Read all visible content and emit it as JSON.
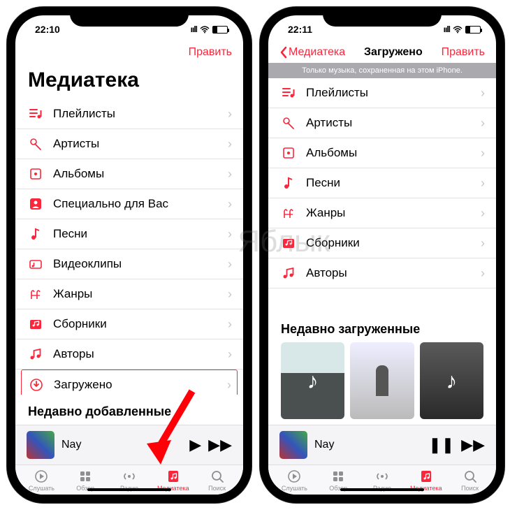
{
  "watermark": "Яблык",
  "phone1": {
    "status_time": "22:10",
    "edit_label": "Править",
    "title": "Медиатека",
    "rows": [
      {
        "icon": "playlist",
        "label": "Плейлисты"
      },
      {
        "icon": "mic",
        "label": "Артисты"
      },
      {
        "icon": "album",
        "label": "Альбомы"
      },
      {
        "icon": "foryou",
        "label": "Специально для Вас"
      },
      {
        "icon": "note",
        "label": "Песни"
      },
      {
        "icon": "video",
        "label": "Видеоклипы"
      },
      {
        "icon": "genre",
        "label": "Жанры"
      },
      {
        "icon": "compilation",
        "label": "Сборники"
      },
      {
        "icon": "composer",
        "label": "Авторы"
      },
      {
        "icon": "download",
        "label": "Загружено",
        "highlight": true
      }
    ],
    "recent_header": "Недавно добавленные",
    "now_playing": "Nay",
    "tabs": [
      {
        "label": "Слушать"
      },
      {
        "label": "Обзор"
      },
      {
        "label": "Радио"
      },
      {
        "label": "Медиатека",
        "active": true
      },
      {
        "label": "Поиск"
      }
    ]
  },
  "phone2": {
    "status_time": "22:11",
    "back_label": "Медиатека",
    "title": "Загружено",
    "edit_label": "Править",
    "banner": "Только музыка, сохраненная на этом iPhone.",
    "rows": [
      {
        "icon": "playlist",
        "label": "Плейлисты"
      },
      {
        "icon": "mic",
        "label": "Артисты"
      },
      {
        "icon": "album",
        "label": "Альбомы"
      },
      {
        "icon": "note",
        "label": "Песни"
      },
      {
        "icon": "genre",
        "label": "Жанры"
      },
      {
        "icon": "compilation",
        "label": "Сборники"
      },
      {
        "icon": "composer",
        "label": "Авторы"
      }
    ],
    "recent_header": "Недавно загруженные",
    "now_playing": "Nay",
    "tabs": [
      {
        "label": "Слушать"
      },
      {
        "label": "Обзор"
      },
      {
        "label": "Радио"
      },
      {
        "label": "Медиатека",
        "active": true
      },
      {
        "label": "Поиск"
      }
    ]
  }
}
